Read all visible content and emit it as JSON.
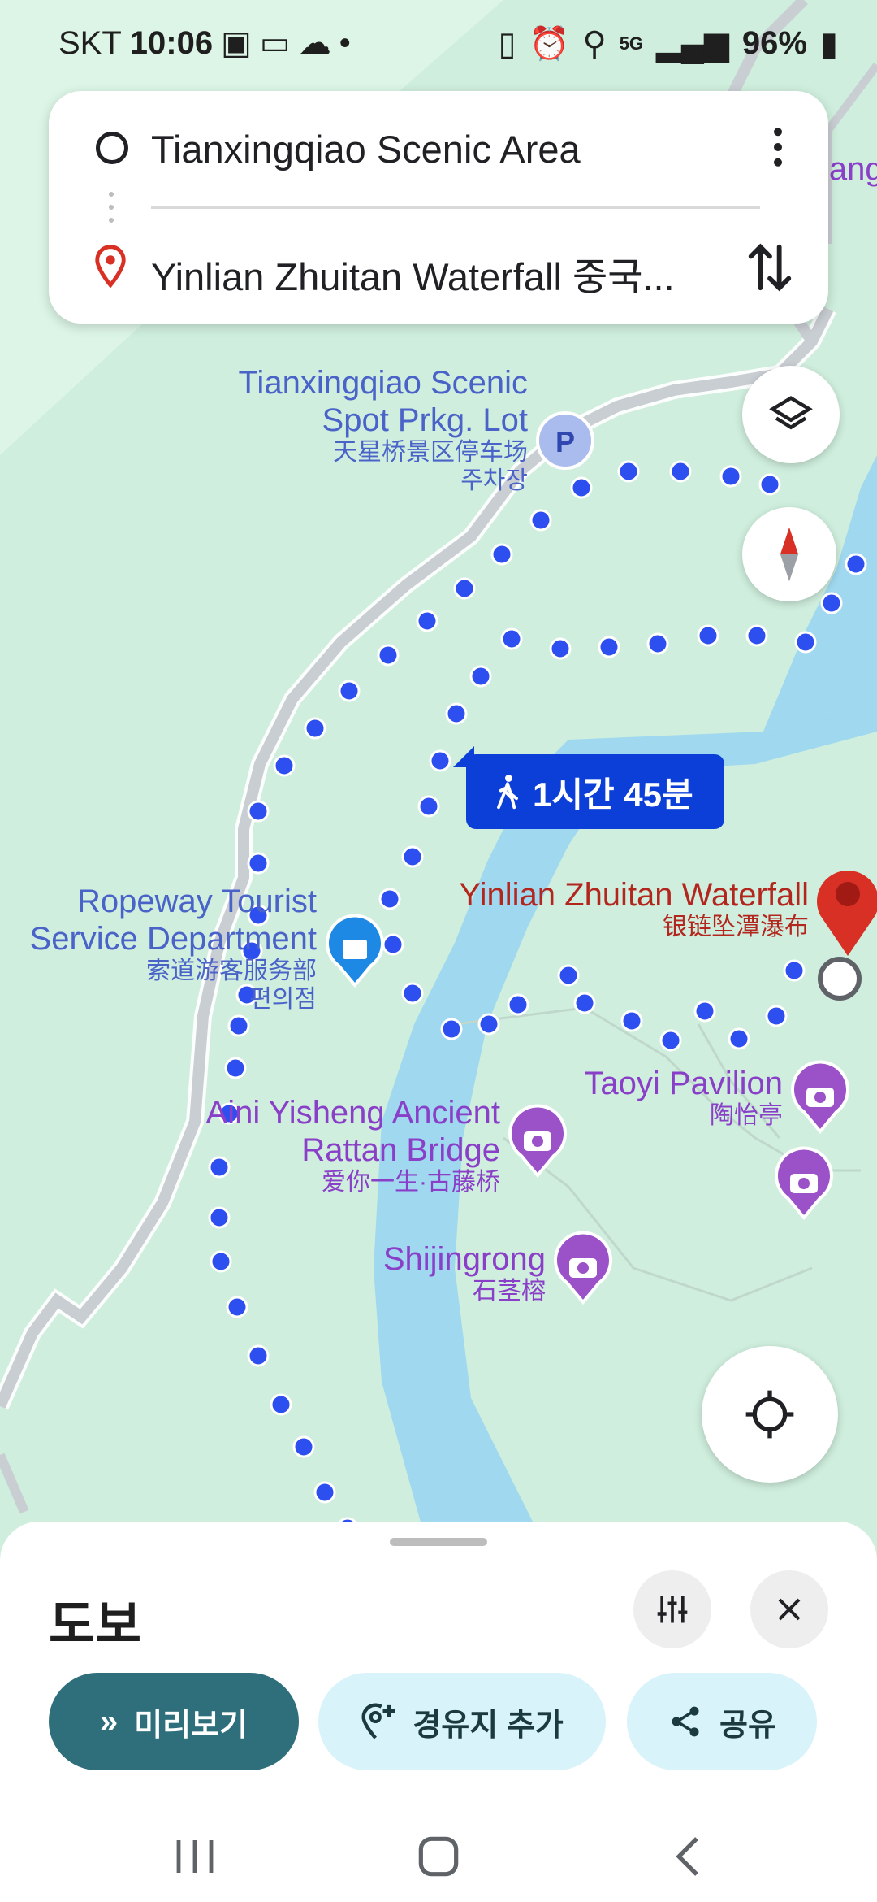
{
  "status_bar": {
    "carrier": "SKT",
    "time": "10:06",
    "network": "5G",
    "battery": "96%"
  },
  "route_card": {
    "origin": "Tianxingqiao Scenic Area",
    "destination": "Yinlian Zhuitan Waterfall 중국...",
    "edge_label": "iang"
  },
  "map_labels": {
    "parking": {
      "en1": "Tianxingqiao Scenic",
      "en2": "Spot Prkg. Lot",
      "zh": "天星桥景区停车场",
      "ko": "주차장",
      "icon": "P"
    },
    "ropeway": {
      "en1": "Ropeway Tourist",
      "en2": "Service Department",
      "zh": "索道游客服务部",
      "ko": "편의점"
    },
    "waterfall": {
      "en": "Yinlian Zhuitan Waterfall",
      "zh": "银链坠潭瀑布"
    },
    "taoyi": {
      "en": "Taoyi Pavilion",
      "zh": "陶怡亭"
    },
    "aini": {
      "en1": "Aini Yisheng Ancient",
      "en2": "Rattan Bridge",
      "zh": "爱你一生·古藤桥"
    },
    "shijingrong": {
      "en": "Shijingrong",
      "zh": "石茎榕"
    }
  },
  "eta_label": "1시간 45분",
  "bottom_sheet": {
    "mode_title": "도보",
    "preview_button": "미리보기",
    "add_stop_button": "경유지 추가",
    "share_button": "공유"
  },
  "colors": {
    "map_bg": "#cfeedd",
    "water": "#9fd8ef",
    "route_dot": "#2d4ff0",
    "eta_bg": "#0b3fd8",
    "preview_bg": "#2f6f7c",
    "pill_light_bg": "#d9f3fb",
    "destination_pin": "#d93025"
  }
}
